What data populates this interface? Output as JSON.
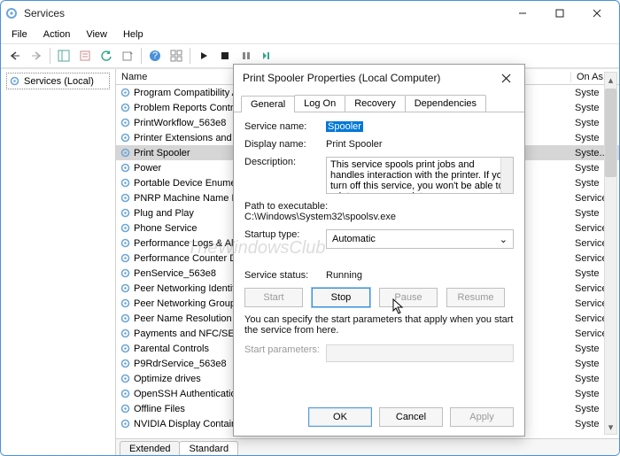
{
  "window": {
    "title": "Services",
    "menu": [
      "File",
      "Action",
      "View",
      "Help"
    ]
  },
  "sidebar": {
    "label": "Services (Local)"
  },
  "columns": {
    "name": "Name",
    "logon": "On As"
  },
  "services": [
    {
      "n": "Program Compatibility A",
      "lo": "Syste"
    },
    {
      "n": "Problem Reports Contro",
      "lo": "Syste"
    },
    {
      "n": "PrintWorkflow_563e8",
      "lo": "Syste"
    },
    {
      "n": "Printer Extensions and N",
      "lo": "Syste"
    },
    {
      "n": "Print Spooler",
      "lo": "Syste...",
      "sel": true
    },
    {
      "n": "Power",
      "lo": "Syste"
    },
    {
      "n": "Portable Device Enumer",
      "lo": "Syste"
    },
    {
      "n": "PNRP Machine Name Pu",
      "lo": "Service"
    },
    {
      "n": "Plug and Play",
      "lo": "Syste"
    },
    {
      "n": "Phone Service",
      "lo": "Service"
    },
    {
      "n": "Performance Logs & Ale",
      "lo": "Service"
    },
    {
      "n": "Performance Counter Dl",
      "lo": "Service"
    },
    {
      "n": "PenService_563e8",
      "lo": "Syste"
    },
    {
      "n": "Peer Networking Identity",
      "lo": "Service"
    },
    {
      "n": "Peer Networking Groupi",
      "lo": "Service"
    },
    {
      "n": "Peer Name Resolution Pr",
      "lo": "Service"
    },
    {
      "n": "Payments and NFC/SE M",
      "lo": "Service"
    },
    {
      "n": "Parental Controls",
      "lo": "Syste"
    },
    {
      "n": "P9RdrService_563e8",
      "lo": "Syste"
    },
    {
      "n": "Optimize drives",
      "lo": "Syste"
    },
    {
      "n": "OpenSSH Authentication",
      "lo": "Syste"
    },
    {
      "n": "Offline Files",
      "lo": "Syste"
    },
    {
      "n": "NVIDIA Display Containe",
      "lo": "Syste"
    }
  ],
  "bottom_tabs": {
    "extended": "Extended",
    "standard": "Standard"
  },
  "dialog": {
    "title": "Print Spooler Properties (Local Computer)",
    "tabs": [
      "General",
      "Log On",
      "Recovery",
      "Dependencies"
    ],
    "labels": {
      "service_name": "Service name:",
      "display_name": "Display name:",
      "description": "Description:",
      "path": "Path to executable:",
      "startup": "Startup type:",
      "status": "Service status:",
      "params": "Start parameters:"
    },
    "values": {
      "service_name": "Spooler",
      "display_name": "Print Spooler",
      "description": "This service spools print jobs and handles interaction with the printer.  If you turn off this service, you won't be able to print or see your printers.",
      "path": "C:\\Windows\\System32\\spoolsv.exe",
      "startup": "Automatic",
      "status": "Running"
    },
    "buttons": {
      "start": "Start",
      "stop": "Stop",
      "pause": "Pause",
      "resume": "Resume"
    },
    "hint": "You can specify the start parameters that apply when you start the service from here.",
    "footer": {
      "ok": "OK",
      "cancel": "Cancel",
      "apply": "Apply"
    }
  },
  "watermark": "TheWindowsClub"
}
